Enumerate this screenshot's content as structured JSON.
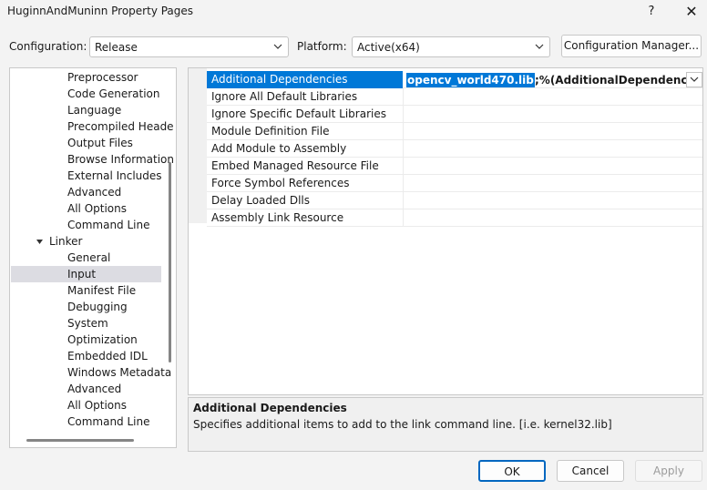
{
  "window": {
    "title": "HuginnAndMuninn Property Pages",
    "help_label": "?",
    "close_label": "✕"
  },
  "config_bar": {
    "configuration_label": "Configuration:",
    "configuration_value": "Release",
    "platform_label": "Platform:",
    "platform_value": "Active(x64)",
    "config_manager_label": "Configuration Manager..."
  },
  "tree": {
    "items": [
      "Preprocessor",
      "Code Generation",
      "Language",
      "Precompiled Heade",
      "Output Files",
      "Browse Information",
      "External Includes",
      "Advanced",
      "All Options",
      "Command Line",
      "Linker",
      "General",
      "Input",
      "Manifest File",
      "Debugging",
      "System",
      "Optimization",
      "Embedded IDL",
      "Windows Metadata",
      "Advanced",
      "All Options",
      "Command Line"
    ],
    "selected": "Input"
  },
  "grid": {
    "properties": [
      "Additional Dependencies",
      "Ignore All Default Libraries",
      "Ignore Specific Default Libraries",
      "Module Definition File",
      "Add Module to Assembly",
      "Embed Managed Resource File",
      "Force Symbol References",
      "Delay Loaded Dlls",
      "Assembly Link Resource"
    ],
    "selected_value_highlight": "opencv_world470.lib",
    "selected_value_rest": ";%(AdditionalDependencies)"
  },
  "description": {
    "title": "Additional Dependencies",
    "text": "Specifies additional items to add to the link command line. [i.e. kernel32.lib]"
  },
  "buttons": {
    "ok": "OK",
    "cancel": "Cancel",
    "apply": "Apply"
  },
  "colors": {
    "accent": "#0078d7",
    "tree_selection": "#dcdce2"
  }
}
